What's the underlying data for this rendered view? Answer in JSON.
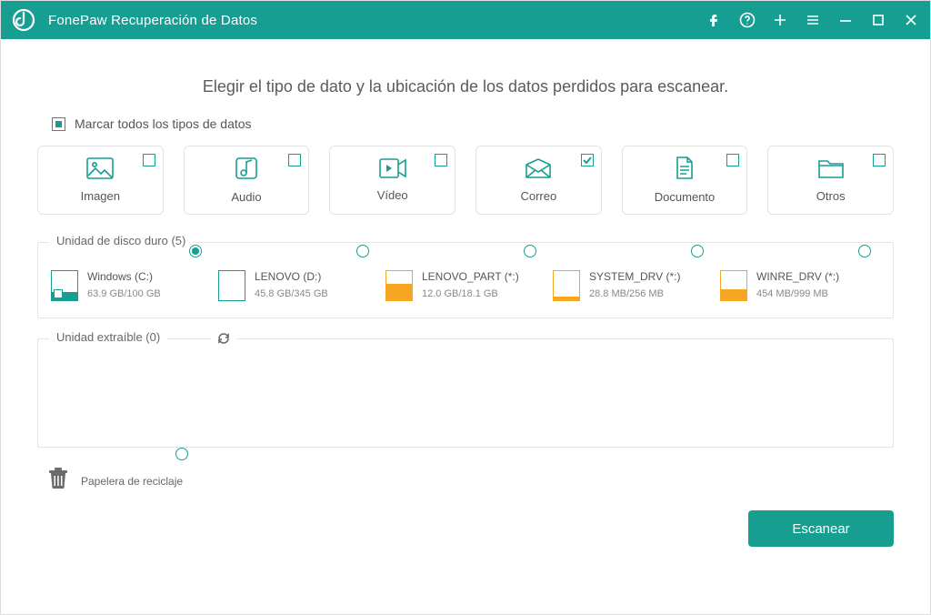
{
  "titlebar": {
    "app_name": "FonePaw Recuperación de Datos"
  },
  "main": {
    "headline": "Elegir el tipo de dato y la ubicación de los datos perdidos para escanear.",
    "check_all_label": "Marcar todos los tipos de datos",
    "types": [
      {
        "label": "Imagen",
        "checked": false
      },
      {
        "label": "Audio",
        "checked": false
      },
      {
        "label": "Vídeo",
        "checked": false
      },
      {
        "label": "Correo",
        "checked": true
      },
      {
        "label": "Documento",
        "checked": false
      },
      {
        "label": "Otros",
        "checked": false
      }
    ],
    "hdd_section_label": "Unidad de disco duro (5)",
    "drives": [
      {
        "name": "Windows (C:)",
        "capacity": "63.9 GB/100 GB",
        "selected": true,
        "fill_pct": 28,
        "theme": "teal",
        "win": true
      },
      {
        "name": "LENOVO (D:)",
        "capacity": "45.8 GB/345 GB",
        "selected": false,
        "fill_pct": 0,
        "theme": "teal",
        "win": false
      },
      {
        "name": "LENOVO_PART (*:)",
        "capacity": "12.0 GB/18.1 GB",
        "selected": false,
        "fill_pct": 55,
        "theme": "orange",
        "win": false
      },
      {
        "name": "SYSTEM_DRV (*:)",
        "capacity": "28.8 MB/256 MB",
        "selected": false,
        "fill_pct": 12,
        "theme": "orange",
        "win": false
      },
      {
        "name": "WINRE_DRV (*:)",
        "capacity": "454 MB/999 MB",
        "selected": false,
        "fill_pct": 36,
        "theme": "orange",
        "win": false
      }
    ],
    "removable_section_label": "Unidad extraíble (0)",
    "recycle_label": "Papelera de reciclaje",
    "scan_button": "Escanear"
  }
}
